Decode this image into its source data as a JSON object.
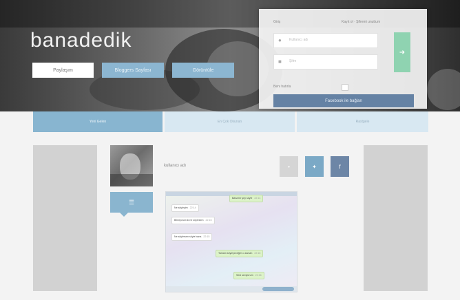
{
  "header": {
    "brand": "banadedik",
    "buttons": [
      {
        "label": "Paylaşım"
      },
      {
        "label": "Bloggers Sayfası"
      },
      {
        "label": "Görüntüle"
      }
    ]
  },
  "login": {
    "title": "Giriş",
    "register_link": "Kayıt ol · Şifremi unuttum",
    "username_placeholder": "Kullanıcı adı",
    "password_placeholder": "Şifre",
    "remember_label": "Beni hatırla",
    "go_icon": "arrow-right-icon",
    "facebook_button": "Facebook ile bağlan"
  },
  "tabs": [
    {
      "label": "Yeni Gelen",
      "active": true
    },
    {
      "label": "En Çok Okunan",
      "active": false
    },
    {
      "label": "Rastgele",
      "active": false
    }
  ],
  "post": {
    "username": "kullanıcı adı",
    "pin_icon": "pin-icon",
    "share_buttons": [
      {
        "icon": "share-icon",
        "color": "#d5d5d5"
      },
      {
        "icon": "twitter-icon",
        "color": "#7ba9c6"
      },
      {
        "icon": "facebook-icon",
        "color": "#6d86a6"
      }
    ]
  },
  "chat": {
    "messages": [
      {
        "side": "right",
        "text": "Bana bir şey söyle",
        "time": "22:14"
      },
      {
        "side": "left",
        "text": "Ne söyleyim",
        "time": "22:14"
      },
      {
        "side": "left",
        "text": "Bilmiyorum ki ne söylesem",
        "time": "22:15"
      },
      {
        "side": "left",
        "text": "Ne söylersen söyle bana",
        "time": "22:15"
      },
      {
        "side": "right",
        "text": "Tamam söyleyeceğim o zaman",
        "time": "22:16"
      },
      {
        "side": "right",
        "text": "Seni seviyorum",
        "time": "22:16"
      }
    ]
  },
  "colors": {
    "accent": "#88b5d0",
    "tab_inactive": "#d8e8f2",
    "go": "#8fd3b1",
    "facebook": "#6582a4"
  }
}
